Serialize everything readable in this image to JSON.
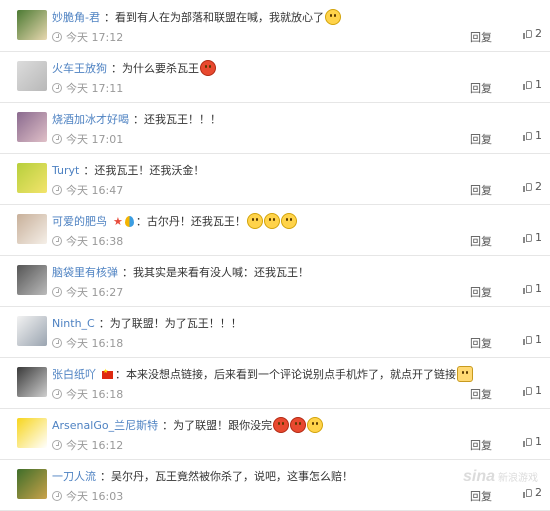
{
  "comments": [
    {
      "avatar": "avatar-pixel-hat",
      "avatar_colors": [
        "#4c7a33",
        "#e8d8b0"
      ],
      "name": "妙脆角-君",
      "text": "看到有人在为部落和联盟在喊，我就放心了",
      "emoji": [
        "smile-emoji"
      ],
      "time": "今天 17:12",
      "reply": "回复",
      "likes": "2"
    },
    {
      "avatar": "avatar-default",
      "avatar_colors": [
        "#dcdcdc",
        "#b8b8b8"
      ],
      "name": "火车王放狗",
      "text": "为什么要杀瓦王",
      "emoji": [
        "angry-emoji"
      ],
      "time": "今天 17:11",
      "reply": "回复",
      "likes": "1"
    },
    {
      "avatar": "avatar-photo",
      "avatar_colors": [
        "#8a6a8e",
        "#e0c0c8"
      ],
      "name": "烧酒加冰才好喝",
      "text": "还我瓦王！！！",
      "emoji": [],
      "time": "今天 17:01",
      "reply": "回复",
      "likes": "1"
    },
    {
      "avatar": "avatar-cartoon-green",
      "avatar_colors": [
        "#b7cf3c",
        "#f3e46c"
      ],
      "name": "Turyt",
      "text": "还我瓦王！还我沃金！",
      "emoji": [],
      "time": "今天 16:47",
      "reply": "回复",
      "likes": "2"
    },
    {
      "avatar": "avatar-cat",
      "avatar_colors": [
        "#c8b09a",
        "#f5efe8"
      ],
      "name": "可爱的肥鸟",
      "badges": true,
      "text": "古尔丹！还我瓦王！",
      "emoji": [
        "sad-emoji",
        "sad-emoji",
        "sad-emoji"
      ],
      "time": "今天 16:38",
      "reply": "回复",
      "likes": "1"
    },
    {
      "avatar": "avatar-bw-photo",
      "avatar_colors": [
        "#555555",
        "#bbbbbb"
      ],
      "name": "脑袋里有核弹",
      "text": "我其实是来看有没人喊：还我瓦王！",
      "emoji": [],
      "time": "今天 16:27",
      "reply": "回复",
      "likes": "1"
    },
    {
      "avatar": "avatar-white-cat",
      "avatar_colors": [
        "#f2f2f2",
        "#9aa4b0"
      ],
      "name": "Ninth_C",
      "text": "为了联盟！为了瓦王！！！",
      "emoji": [],
      "time": "今天 16:18",
      "reply": "回复",
      "likes": "1"
    },
    {
      "avatar": "avatar-sketch",
      "avatar_colors": [
        "#3a3a3a",
        "#cfcfcf"
      ],
      "name": "张白纸吖",
      "flag": true,
      "text": "本来没想点链接，后来看到一个评论说别点手机炸了，就点开了链接",
      "emoji": [
        "cat-emoji"
      ],
      "time": "今天 16:18",
      "reply": "回复",
      "likes": "1"
    },
    {
      "avatar": "avatar-yellow-face",
      "avatar_colors": [
        "#f7d51d",
        "#ffffff"
      ],
      "name": "ArsenalGo_兰尼斯特",
      "text": "为了联盟！跟你没完",
      "emoji": [
        "angry-red-emoji",
        "angry-red-emoji",
        "frown-emoji"
      ],
      "time": "今天 16:12",
      "reply": "回复",
      "likes": "1"
    },
    {
      "avatar": "avatar-game-art",
      "avatar_colors": [
        "#3f6e2a",
        "#c9a24a"
      ],
      "name": "一刀人流",
      "text": "吴尔丹，瓦王竟然被你杀了，说吧，这事怎么赔！",
      "emoji": [],
      "time": "今天 16:03",
      "reply": "回复",
      "likes": "2"
    }
  ],
  "separator": "：",
  "watermark": {
    "logo": "sina",
    "sub": "新浪游戏"
  },
  "colors": {
    "name": "#4e82c2",
    "meta": "#999999",
    "divider": "#e6e6e6"
  }
}
